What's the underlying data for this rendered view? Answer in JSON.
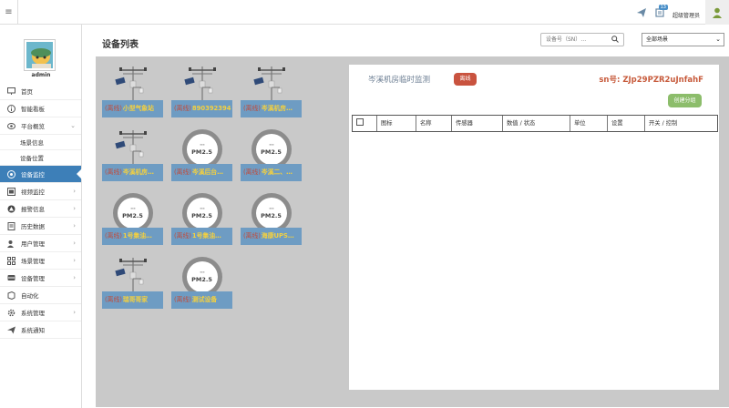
{
  "header": {
    "menu_icon": "hamburger-icon",
    "message_icon": "paper-plane-icon",
    "notify_icon": "notification-icon",
    "notify_count": "13",
    "username": "超级管理员",
    "user_icon": "user-icon"
  },
  "sidebar": {
    "profile_name": "admin",
    "items": [
      {
        "label": "首页",
        "icon": "monitor-icon"
      },
      {
        "label": "智能看板",
        "icon": "info-icon"
      },
      {
        "label": "平台概览",
        "icon": "eye-icon"
      },
      {
        "label": "场景信息"
      },
      {
        "label": "设备位置"
      },
      {
        "label": "设备监控",
        "icon": "radar-icon"
      },
      {
        "label": "视频监控",
        "icon": "video-icon"
      },
      {
        "label": "报警信息",
        "icon": "alert-icon"
      },
      {
        "label": "历史数据",
        "icon": "history-icon"
      },
      {
        "label": "用户管理",
        "icon": "users-icon"
      },
      {
        "label": "场景管理",
        "icon": "grid-icon"
      },
      {
        "label": "设备管理",
        "icon": "device-icon"
      },
      {
        "label": "自动化",
        "icon": "automation-icon"
      },
      {
        "label": "系统管理",
        "icon": "gear-icon"
      },
      {
        "label": "系统通知",
        "icon": "send-icon"
      }
    ]
  },
  "main": {
    "title": "设备列表",
    "search_placeholder": "设备号（SN）…",
    "scene_select": "全部场景",
    "devices": [
      {
        "status": "(离线)",
        "name": "小型气象站",
        "type": "weather"
      },
      {
        "status": "(离线)",
        "name": "890392394",
        "type": "weather"
      },
      {
        "status": "(离线)",
        "name": "岑溪机房…",
        "type": "weather"
      },
      {
        "status": "(离线)",
        "name": "岑溪机房…",
        "type": "weather"
      },
      {
        "status": "(离线)",
        "name": "岑溪后台…",
        "type": "pm25"
      },
      {
        "status": "(离线)",
        "name": "岑溪二、…",
        "type": "pm25"
      },
      {
        "status": "(离线)",
        "name": "1号集油…",
        "type": "pm25"
      },
      {
        "status": "(离线)",
        "name": "1号集油…",
        "type": "pm25"
      },
      {
        "status": "(离线)",
        "name": "海康UPS…",
        "type": "pm25"
      },
      {
        "status": "(离线)",
        "name": "瑞哥哥家",
        "type": "weather"
      },
      {
        "status": "(离线)",
        "name": "测试设备",
        "type": "pm25"
      }
    ],
    "pm25_label": "PM2.5",
    "detail": {
      "title": "岑溪机房临时监测",
      "status": "离线",
      "sn": "sn号: ZJp29PZR2uJnfahF",
      "group_button": "创建分组",
      "columns": [
        "",
        "图标",
        "名称",
        "传感器",
        "数值 / 状态",
        "单位",
        "设置",
        "开关 / 控制"
      ]
    }
  },
  "colors": {
    "active_nav": "#3d7fb8",
    "caption_bg": "#6e9cc3",
    "offline_text": "#c24b3a",
    "device_name": "#f4d03f",
    "offline_button": "#c9533f",
    "group_button": "#8cbd6b",
    "sn_text": "#c75b3c"
  }
}
